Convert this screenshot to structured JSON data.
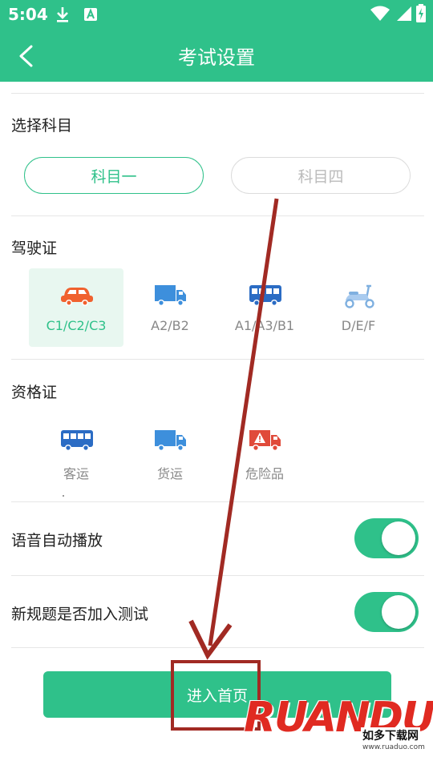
{
  "status": {
    "time": "5:04"
  },
  "header": {
    "title": "考试设置"
  },
  "subject": {
    "title": "选择科目",
    "options": [
      {
        "label": "科目一",
        "selected": true
      },
      {
        "label": "科目四",
        "selected": false
      }
    ]
  },
  "license": {
    "title": "驾驶证",
    "items": [
      {
        "label": "C1/C2/C3",
        "icon": "car-icon",
        "selected": true
      },
      {
        "label": "A2/B2",
        "icon": "truck-icon",
        "selected": false
      },
      {
        "label": "A1/A3/B1",
        "icon": "bus-icon",
        "selected": false
      },
      {
        "label": "D/E/F",
        "icon": "scooter-icon",
        "selected": false
      }
    ]
  },
  "qualification": {
    "title": "资格证",
    "items": [
      {
        "label": "客运",
        "icon": "bus-icon"
      },
      {
        "label": "货运",
        "icon": "truck-icon"
      },
      {
        "label": "危险品",
        "icon": "hazmat-truck-icon"
      }
    ]
  },
  "settings": {
    "voice_autoplay": {
      "label": "语音自动播放",
      "on": true
    },
    "new_rules": {
      "label": "新规题是否加入测试",
      "on": true
    }
  },
  "enter_button": {
    "label": "进入首页"
  },
  "watermark": {
    "logo": "RUANDUO",
    "cn": "如多下载网",
    "url": "www.ruaduo.com"
  },
  "colors": {
    "accent": "#2fc18a",
    "annotation": "#a12a23",
    "car": "#f0612e",
    "vehicle_blue": "#3d8fdc"
  }
}
